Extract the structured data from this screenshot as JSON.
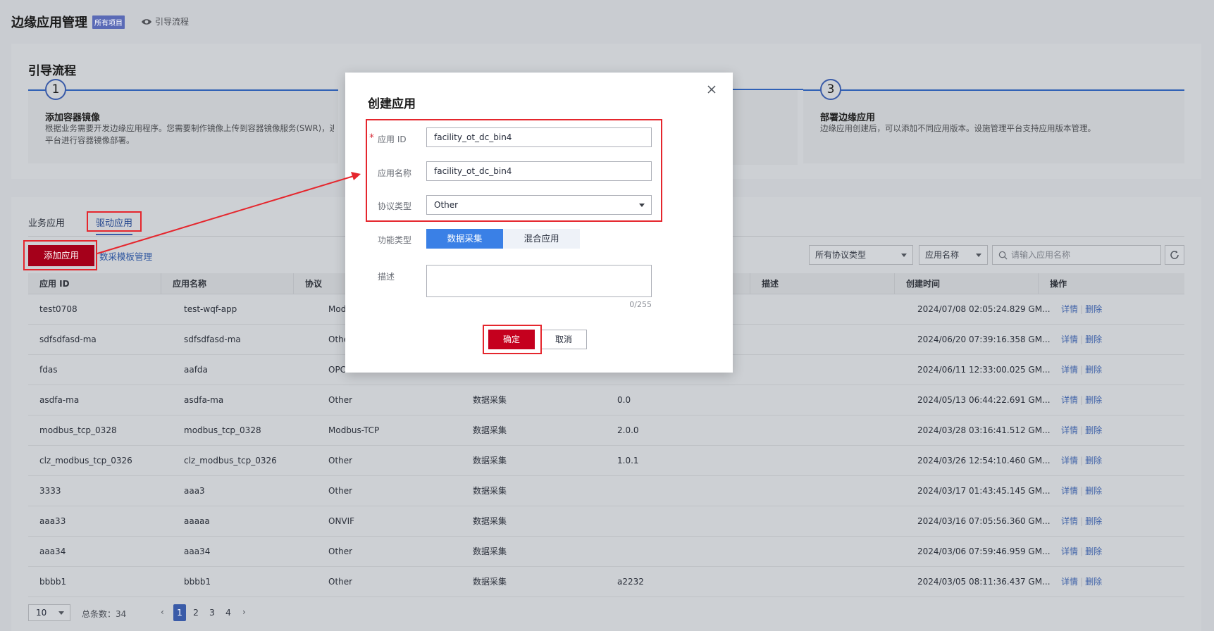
{
  "header": {
    "title": "边缘应用管理",
    "project_badge": "所有项目",
    "guide_link": "引导流程"
  },
  "guide": {
    "title": "引导流程",
    "steps": [
      {
        "number": "1",
        "title": "添加容器镜像",
        "desc_line1": "根据业务需要开发边缘应用程序。您需要制作镜像上传到容器镜像服务(SWR)，进",
        "desc_line2": "平台进行容器镜像部署。"
      },
      {
        "number": "3",
        "title": "部署边缘应用",
        "desc_line1": "边缘应用创建后，可以添加不同应用版本。设施管理平台支持应用版本管理。"
      }
    ]
  },
  "tabs": [
    {
      "label": "业务应用"
    },
    {
      "label": "驱动应用"
    }
  ],
  "toolbar": {
    "add_label": "添加应用",
    "template_link": "数采模板管理",
    "protocol_filter": "所有协议类型",
    "name_filter": "应用名称",
    "search_placeholder": "请输入应用名称"
  },
  "table": {
    "headers": [
      "应用 ID",
      "应用名称",
      "协议",
      "描述",
      "创建时间",
      "操作"
    ],
    "rows": [
      {
        "id": "test0708",
        "name": "test-wqf-app",
        "protocol": "Mod",
        "type": "",
        "version": "",
        "created": "2024/07/08 02:05:24.829 GM..."
      },
      {
        "id": "sdfsdfasd-ma",
        "name": "sdfsdfasd-ma",
        "protocol": "Othe",
        "type": "",
        "version": "",
        "created": "2024/06/20 07:39:16.358 GM..."
      },
      {
        "id": "fdas",
        "name": "aafda",
        "protocol": "OPC",
        "type": "",
        "version": "",
        "created": "2024/06/11 12:33:00.025 GM..."
      },
      {
        "id": "asdfa-ma",
        "name": "asdfa-ma",
        "protocol": "Other",
        "type": "数据采集",
        "version": "0.0",
        "created": "2024/05/13 06:44:22.691 GM..."
      },
      {
        "id": "modbus_tcp_0328",
        "name": "modbus_tcp_0328",
        "protocol": "Modbus-TCP",
        "type": "数据采集",
        "version": "2.0.0",
        "created": "2024/03/28 03:16:41.512 GM..."
      },
      {
        "id": "clz_modbus_tcp_0326",
        "name": "clz_modbus_tcp_0326",
        "protocol": "Other",
        "type": "数据采集",
        "version": "1.0.1",
        "created": "2024/03/26 12:54:10.460 GM..."
      },
      {
        "id": "3333",
        "name": "aaa3",
        "protocol": "Other",
        "type": "数据采集",
        "version": "",
        "created": "2024/03/17 01:43:45.145 GM..."
      },
      {
        "id": "aaa33",
        "name": "aaaaa",
        "protocol": "ONVIF",
        "type": "数据采集",
        "version": "",
        "created": "2024/03/16 07:05:56.360 GM..."
      },
      {
        "id": "aaa34",
        "name": "aaa34",
        "protocol": "Other",
        "type": "数据采集",
        "version": "",
        "created": "2024/03/06 07:59:46.959 GM..."
      },
      {
        "id": "bbbb1",
        "name": "bbbb1",
        "protocol": "Other",
        "type": "数据采集",
        "version": "a2232",
        "created": "2024/03/05 08:11:36.437 GM..."
      }
    ],
    "op_detail": "详情",
    "op_delete": "删除"
  },
  "pager": {
    "page_size": "10",
    "total": "总条数：34",
    "pages": [
      "1",
      "2",
      "3",
      "4"
    ],
    "prev_glyph": "‹",
    "next_glyph": "›"
  },
  "modal": {
    "title": "创建应用",
    "required_mark": "*",
    "app_id_label": "应用 ID",
    "app_id_value": "facility_ot_dc_bin4",
    "app_name_label": "应用名称",
    "app_name_value": "facility_ot_dc_bin4",
    "protocol_label": "协议类型",
    "protocol_value": "Other",
    "function_label": "功能类型",
    "function_on": "数据采集",
    "function_off": "混合应用",
    "desc_label": "描述",
    "desc_counter": "0/255",
    "ok_label": "确定",
    "cancel_label": "取消"
  },
  "colors": {
    "accent_red": "#c5001e",
    "annotation_red": "#e5262d",
    "primary_blue": "#3a80e6"
  }
}
